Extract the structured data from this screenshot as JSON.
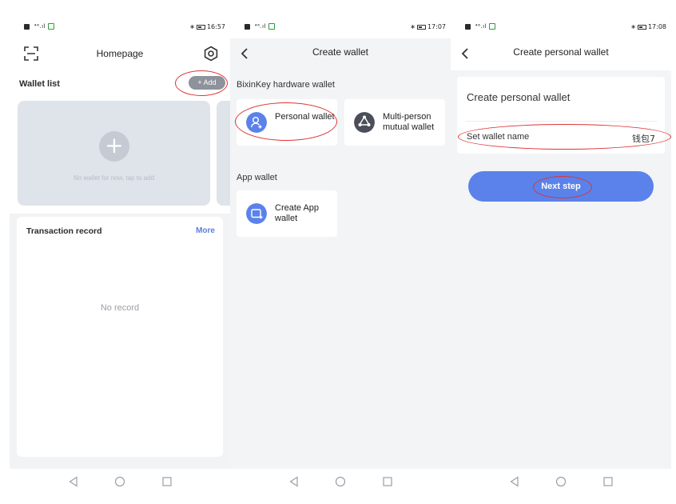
{
  "status_bars": [
    {
      "signal": "  ⁴⁶.ıl",
      "time": "16:57"
    },
    {
      "signal": "  ⁴⁶.ıl",
      "time": "17:07"
    },
    {
      "signal": "  ⁴⁶.ıl",
      "time": "17:08"
    }
  ],
  "home": {
    "title": "Homepage",
    "wallet_list_label": "Wallet list",
    "add_button": "+ Add",
    "empty_hint": "No wallet for now, tap to add",
    "transaction_label": "Transaction record",
    "more_link": "More",
    "no_record": "No record"
  },
  "create_wallet": {
    "title": "Create wallet",
    "hardware_section": "BixinKey hardware wallet",
    "personal_wallet": "Personal wallet",
    "multi_wallet": "Multi-person mutual wallet",
    "app_section": "App wallet",
    "create_app_wallet": "Create App wallet"
  },
  "personal_wallet": {
    "title": "Create personal wallet",
    "heading": "Create personal wallet",
    "name_label": "Set wallet name",
    "name_value": "钱包7",
    "next_button": "Next step"
  },
  "colors": {
    "accent": "#5b82ea",
    "annotation": "#dd3333",
    "card_empty": "#dfe3ea"
  },
  "icons": [
    "scan-icon",
    "settings-icon",
    "back-icon",
    "user-add-icon",
    "multi-user-icon",
    "app-wallet-icon",
    "nav-back-icon",
    "nav-home-icon",
    "nav-recent-icon"
  ]
}
